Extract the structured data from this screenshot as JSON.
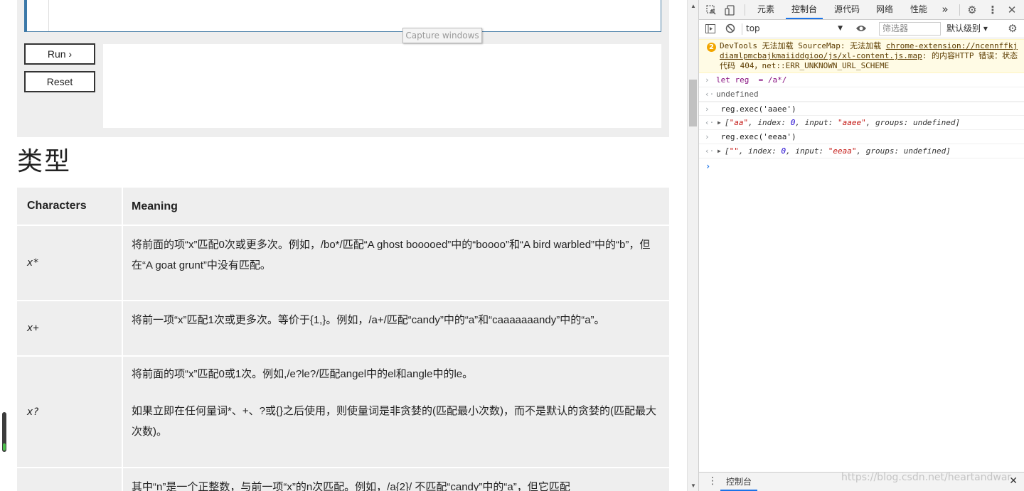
{
  "page": {
    "run_label": "Run ›",
    "reset_label": "Reset",
    "capture_tooltip": "Capture windows",
    "section_heading": "类型",
    "table": {
      "headers": [
        "Characters",
        "Meaning"
      ],
      "rows": [
        {
          "char": "x*",
          "paragraphs": [
            "将前面的项“x”匹配0次或更多次。例如，/bo*/匹配“A ghost booooed”中的“boooo”和“A bird warbled”中的“b”，但在“A goat grunt”中没有匹配。"
          ]
        },
        {
          "char": "x+",
          "paragraphs": [
            "将前一项“x”匹配1次或更多次。等价于{1,}。例如，/a+/匹配“candy”中的“a”和“caaaaaaandy”中的“a”。"
          ]
        },
        {
          "char": "x?",
          "paragraphs": [
            "将前面的项“x”匹配0或1次。例如,/e?le?/匹配angel中的el和angle中的le。",
            "如果立即在任何量词*、+、?或{}之后使用，则使量词是非贪婪的(匹配最小次数)，而不是默认的贪婪的(匹配最大次数)。"
          ]
        },
        {
          "char": "",
          "paragraphs": [
            "其中“n”是一个正整数，与前一项“x”的n次匹配。例如，/a{2}/ 不匹配“candy”中的“a”，但它匹配"
          ]
        }
      ]
    }
  },
  "devtools": {
    "tabs": [
      "元素",
      "控制台",
      "源代码",
      "网络",
      "性能"
    ],
    "active_tab": "控制台",
    "more_tabs": "»",
    "context": "top",
    "filter_placeholder": "筛选器",
    "levels": "默认级别 ▾",
    "warning": {
      "count": "2",
      "text_before": "DevTools 无法加载 SourceMap: 无法加载 ",
      "link": "chrome-extension://ncennffkjdiamlpmcbajkmaiiddgioo/js/xl-content.js.map",
      "text_after": ": 的内容HTTP 错误：状态代码 404，net::ERR_UNKNOWN_URL_SCHEME"
    },
    "entries": [
      {
        "type": "input",
        "text": "let reg  = /a*/"
      },
      {
        "type": "result",
        "text": "undefined"
      },
      {
        "type": "input",
        "text": " reg.exec('aaee')"
      },
      {
        "type": "object",
        "parts": [
          "[",
          "\"aa\"",
          ", index: ",
          "0",
          ", input: ",
          "\"aaee\"",
          ", groups: undefined]"
        ]
      },
      {
        "type": "input",
        "text": " reg.exec('eeaa')"
      },
      {
        "type": "object",
        "parts": [
          "[",
          "\"\"",
          ", index: ",
          "0",
          ", input: ",
          "\"eeaa\"",
          ", groups: undefined]"
        ]
      }
    ],
    "drawer_tab": "控制台",
    "watermark": "https://blog.csdn.net/heartandwar"
  },
  "icons": [
    "inspect-icon",
    "device-toggle-icon",
    "settings-gear-icon",
    "kebab-menu-icon",
    "close-icon",
    "sidebar-toggle-icon",
    "clear-console-icon",
    "eye-icon",
    "console-settings-icon",
    "warning-badge-icon",
    "chevron-down-icon"
  ]
}
